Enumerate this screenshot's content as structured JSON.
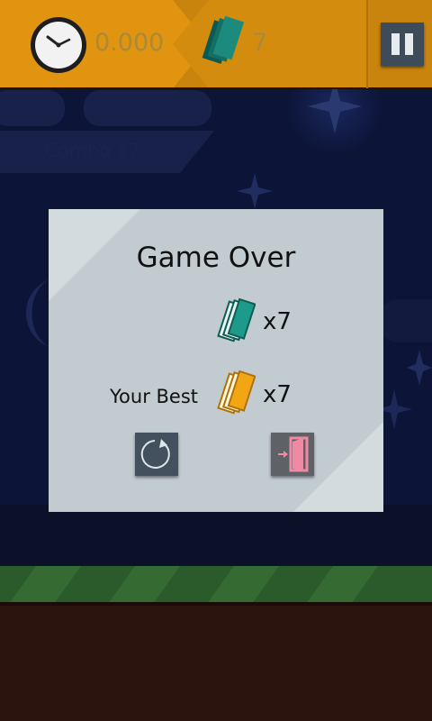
{
  "hud": {
    "timer_value": "0.000",
    "tickets_value": "7",
    "combo_label": "Combo x7"
  },
  "dialog": {
    "title": "Game Over",
    "score_count": "x7",
    "best_label": "Your Best",
    "best_count": "x7"
  },
  "colors": {
    "hud_bar": "#c8840d",
    "night_sky": "#0c1437",
    "panel": "#c2cbcf",
    "ticket_teal": "#1e9a8a",
    "ticket_gold": "#f3a614",
    "grass": "#2b5a2b",
    "soil": "#2b140e"
  }
}
